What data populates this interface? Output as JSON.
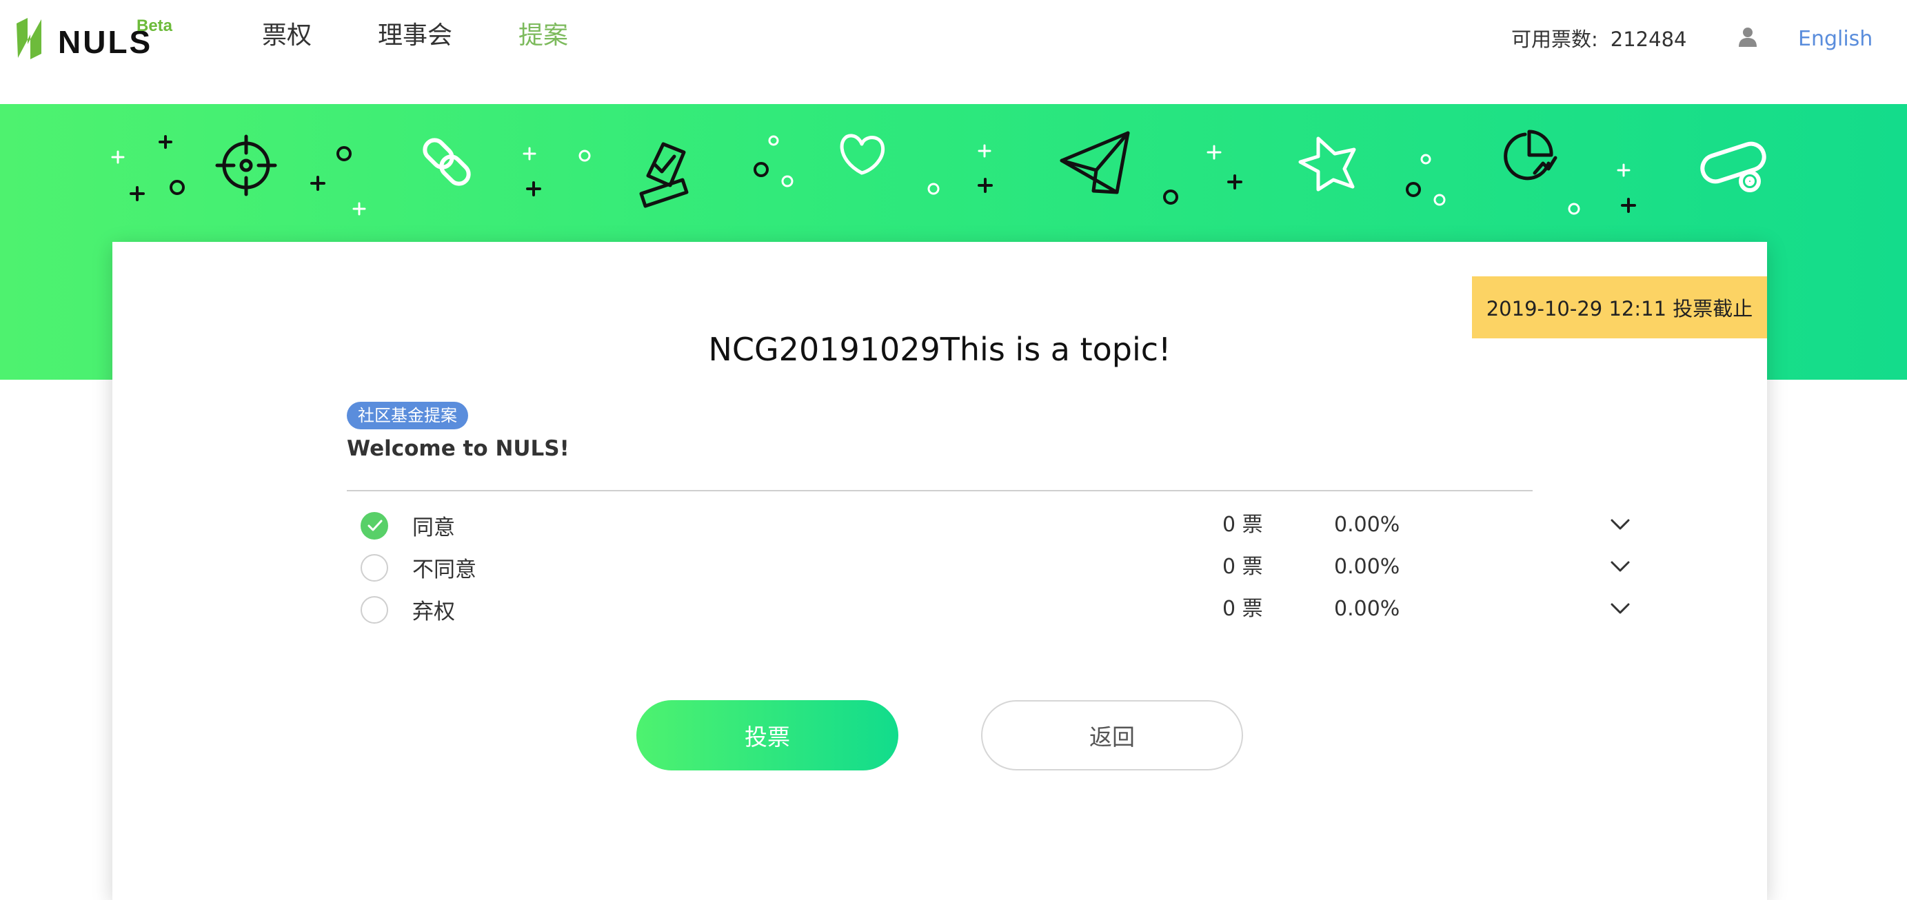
{
  "header": {
    "logo_text": "NULS",
    "beta": "Beta",
    "nav": [
      "票权",
      "理事会",
      "提案"
    ],
    "active_nav": "提案",
    "votes_label": "可用票数:",
    "votes_value": "212484",
    "language": "English",
    "icons": {
      "user": "user-icon"
    }
  },
  "banner": {
    "icons": [
      "crosshair-icon",
      "link-icon",
      "ballot-icon",
      "heart-icon",
      "paper-plane-icon",
      "star-icon",
      "pie-chart-icon",
      "toggle-icon"
    ]
  },
  "proposal": {
    "deadline": "2019-10-29 12:11 投票截止",
    "title": "NCG20191029This is a topic!",
    "tag": "社区基金提案",
    "description": "Welcome to NULS!",
    "options": [
      {
        "label": "同意",
        "votes": "0 票",
        "percent": "0.00%",
        "selected": true
      },
      {
        "label": "不同意",
        "votes": "0 票",
        "percent": "0.00%",
        "selected": false
      },
      {
        "label": "弃权",
        "votes": "0 票",
        "percent": "0.00%",
        "selected": false
      }
    ],
    "vote_button": "投票",
    "back_button": "返回"
  },
  "colors": {
    "accent_green": "#7cba5c",
    "banner_start": "#4ef26f",
    "banner_end": "#14dc8b",
    "tag_blue": "#5a8ddc",
    "deadline_yellow": "#fcd364",
    "check_green": "#58d068"
  }
}
